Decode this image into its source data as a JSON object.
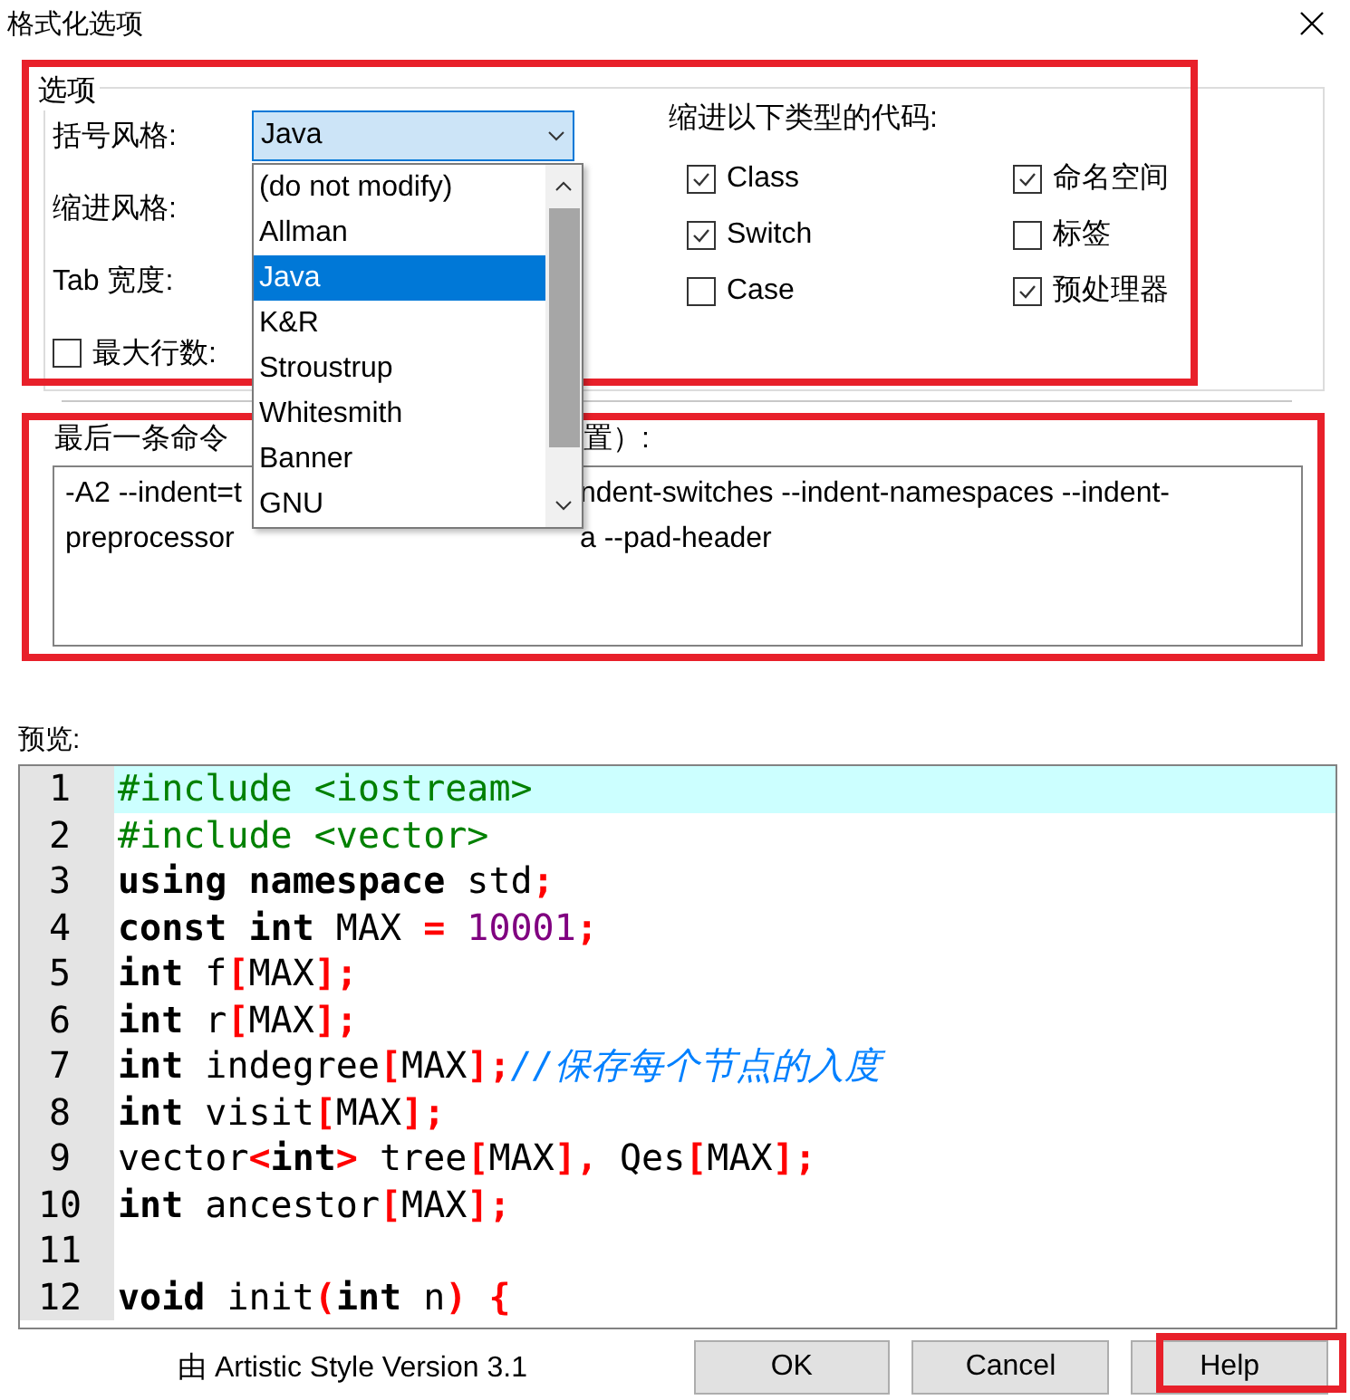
{
  "window": {
    "title": "格式化选项"
  },
  "options": {
    "legend": "选项",
    "rows": [
      {
        "kind": "combo",
        "label": "括号风格:"
      },
      {
        "kind": "plain",
        "label": "缩进风格:"
      },
      {
        "kind": "plain",
        "label": "Tab 宽度:"
      },
      {
        "kind": "check",
        "label": "最大行数:",
        "checked": false
      }
    ],
    "combo": {
      "value": "Java",
      "items": [
        {
          "label": "(do not modify)",
          "selected": false
        },
        {
          "label": "Allman",
          "selected": false
        },
        {
          "label": "Java",
          "selected": true
        },
        {
          "label": "K&R",
          "selected": false
        },
        {
          "label": "Stroustrup",
          "selected": false
        },
        {
          "label": "Whitesmith",
          "selected": false
        },
        {
          "label": "Banner",
          "selected": false
        },
        {
          "label": "GNU",
          "selected": false
        }
      ]
    },
    "indent_heading": "缩进以下类型的代码:",
    "indent_checks": [
      {
        "label": "Class",
        "checked": true
      },
      {
        "label": "命名空间",
        "checked": true
      },
      {
        "label": "Switch",
        "checked": true
      },
      {
        "label": "标签",
        "checked": false
      },
      {
        "label": "Case",
        "checked": false
      },
      {
        "label": "预处理器",
        "checked": true
      }
    ]
  },
  "command": {
    "label_parts": [
      "最后一条命令",
      "置）:"
    ],
    "lines": [
      [
        "-A2 --indent=t",
        "ndent-switches --indent-namespaces --indent-"
      ],
      [
        "preprocessor",
        "a --pad-header"
      ]
    ]
  },
  "preview": {
    "label": "预览:",
    "lines": [
      {
        "number": "1",
        "current": true,
        "tokens": [
          {
            "kind": "pre",
            "text": "#include <iostream>"
          }
        ]
      },
      {
        "number": "2",
        "current": false,
        "tokens": [
          {
            "kind": "pre",
            "text": "#include <vector>"
          }
        ]
      },
      {
        "number": "3",
        "current": false,
        "tokens": [
          {
            "kind": "kw",
            "text": "using namespace"
          },
          {
            "kind": "id",
            "text": " std"
          },
          {
            "kind": "op",
            "text": ";"
          }
        ]
      },
      {
        "number": "4",
        "current": false,
        "tokens": [
          {
            "kind": "kw",
            "text": "const int"
          },
          {
            "kind": "id",
            "text": " MAX"
          },
          {
            "kind": "op",
            "text": " = "
          },
          {
            "kind": "num",
            "text": "10001"
          },
          {
            "kind": "op",
            "text": ";"
          }
        ]
      },
      {
        "number": "5",
        "current": false,
        "tokens": [
          {
            "kind": "kw",
            "text": "int"
          },
          {
            "kind": "id",
            "text": " f"
          },
          {
            "kind": "op",
            "text": "["
          },
          {
            "kind": "id",
            "text": "MAX"
          },
          {
            "kind": "op",
            "text": "];"
          }
        ]
      },
      {
        "number": "6",
        "current": false,
        "tokens": [
          {
            "kind": "kw",
            "text": "int"
          },
          {
            "kind": "id",
            "text": " r"
          },
          {
            "kind": "op",
            "text": "["
          },
          {
            "kind": "id",
            "text": "MAX"
          },
          {
            "kind": "op",
            "text": "];"
          }
        ]
      },
      {
        "number": "7",
        "current": false,
        "tokens": [
          {
            "kind": "kw",
            "text": "int"
          },
          {
            "kind": "id",
            "text": " indegree"
          },
          {
            "kind": "op",
            "text": "["
          },
          {
            "kind": "id",
            "text": "MAX"
          },
          {
            "kind": "op",
            "text": "];"
          },
          {
            "kind": "comment",
            "text": "//保存每个节点的入度"
          }
        ]
      },
      {
        "number": "8",
        "current": false,
        "tokens": [
          {
            "kind": "kw",
            "text": "int"
          },
          {
            "kind": "id",
            "text": " visit"
          },
          {
            "kind": "op",
            "text": "["
          },
          {
            "kind": "id",
            "text": "MAX"
          },
          {
            "kind": "op",
            "text": "];"
          }
        ]
      },
      {
        "number": "9",
        "current": false,
        "tokens": [
          {
            "kind": "id",
            "text": "vector"
          },
          {
            "kind": "op",
            "text": "<"
          },
          {
            "kind": "kw",
            "text": "int"
          },
          {
            "kind": "op",
            "text": ">"
          },
          {
            "kind": "id",
            "text": " tree"
          },
          {
            "kind": "op",
            "text": "["
          },
          {
            "kind": "id",
            "text": "MAX"
          },
          {
            "kind": "op",
            "text": "],"
          },
          {
            "kind": "id",
            "text": " Qes"
          },
          {
            "kind": "op",
            "text": "["
          },
          {
            "kind": "id",
            "text": "MAX"
          },
          {
            "kind": "op",
            "text": "];"
          }
        ]
      },
      {
        "number": "10",
        "current": false,
        "tokens": [
          {
            "kind": "kw",
            "text": "int"
          },
          {
            "kind": "id",
            "text": " ancestor"
          },
          {
            "kind": "op",
            "text": "["
          },
          {
            "kind": "id",
            "text": "MAX"
          },
          {
            "kind": "op",
            "text": "];"
          }
        ]
      },
      {
        "number": "11",
        "current": false
      },
      {
        "number": "12",
        "current": false,
        "tokens": [
          {
            "kind": "kw",
            "text": "void"
          },
          {
            "kind": "id",
            "text": " init"
          },
          {
            "kind": "op",
            "text": "("
          },
          {
            "kind": "kw",
            "text": "int"
          },
          {
            "kind": "id",
            "text": " n"
          },
          {
            "kind": "op",
            "text": ") {"
          }
        ]
      }
    ]
  },
  "footer": {
    "credit": "由 Artistic Style Version 3.1",
    "buttons": [
      "OK",
      "Cancel",
      "Help"
    ]
  }
}
